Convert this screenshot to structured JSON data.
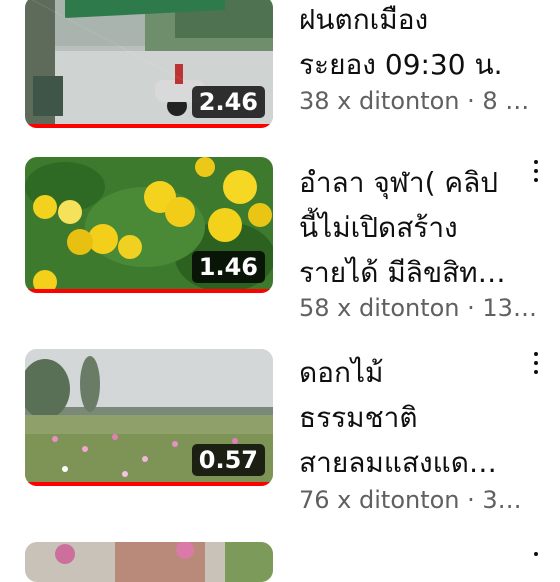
{
  "videos": [
    {
      "title_lines": [
        "ฝนตกเมือง",
        "ระยอง 09:30 น."
      ],
      "meta": "38 x ditonton · 8 h…",
      "duration": "2.46",
      "watched_fraction": 1.0,
      "thumbnail": "rain-street-scooter"
    },
    {
      "title_lines": [
        "อำลา จุฬา( คลิป",
        "นี้ไม่เปิดสร้าง",
        "รายได้ มีลิขสิท…"
      ],
      "meta": "58 x ditonton · 13…",
      "duration": "1.46",
      "watched_fraction": 1.0,
      "thumbnail": "yellow-flowers"
    },
    {
      "title_lines": [
        "ดอกไม้",
        "ธรรมชาติ",
        "สายลมแสงแด…"
      ],
      "meta": "76 x ditonton · 3…",
      "duration": "0.57",
      "watched_fraction": 1.0,
      "thumbnail": "wildflower-field"
    },
    {
      "title_lines": [
        "…"
      ],
      "meta": "",
      "duration": "",
      "watched_fraction": 0,
      "thumbnail": "flowers-house"
    }
  ],
  "colors": {
    "progress": "#ff0000",
    "title": "#0f0f0f",
    "meta": "#606060",
    "duration_bg": "#000000"
  },
  "icons": {
    "menu": "more-vert-icon"
  }
}
